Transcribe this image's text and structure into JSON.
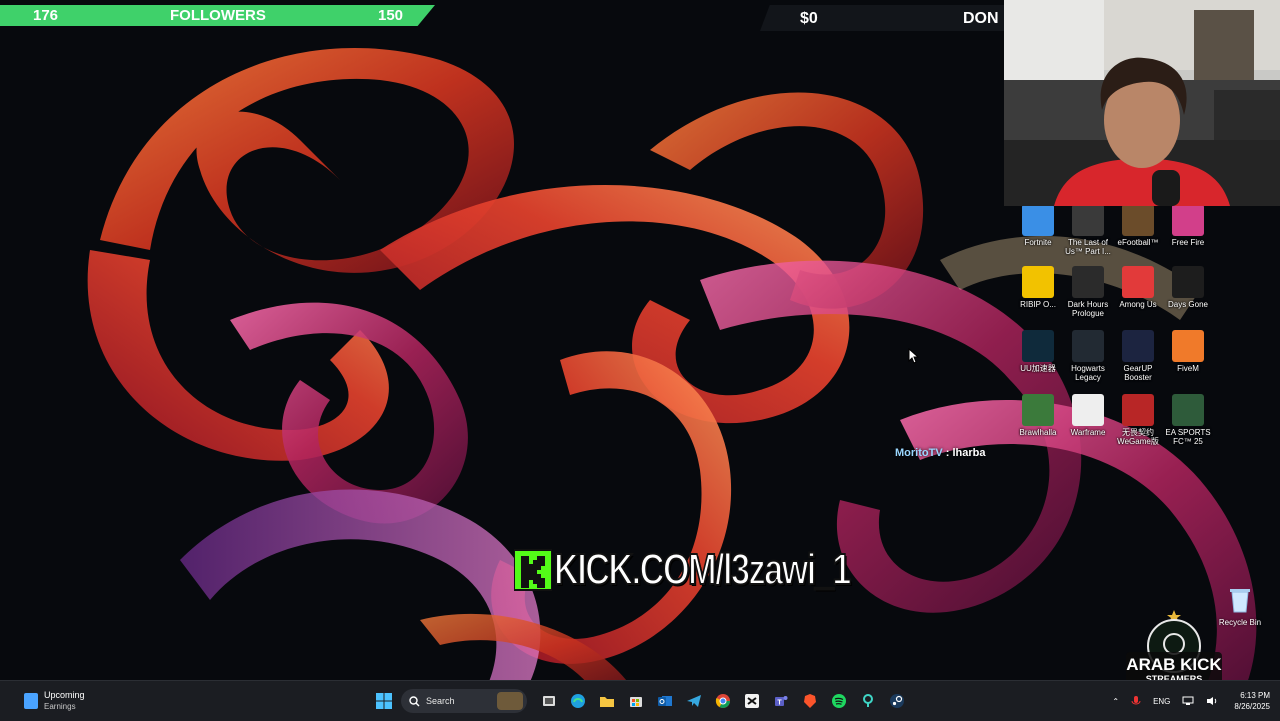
{
  "stream_overlay": {
    "followers_current": "176",
    "followers_label": "FOLLOWERS",
    "followers_goal": "150",
    "donation_amount": "$0",
    "donation_label": "DON",
    "kick_url": "KICK.COM/l3zawi_1",
    "watermark_line1": "ARAB KICK",
    "watermark_line2": "STREAMERS"
  },
  "chat": {
    "username": "MoritoTV",
    "separator": ":",
    "message": "lharba"
  },
  "desktop": {
    "icons": [
      {
        "label": "Fortnite",
        "icon": "fortnite-icon",
        "color": "#3a8fe6"
      },
      {
        "label": "The Last of Us™ Part I...",
        "icon": "last-of-us-icon",
        "color": "#3a3a3a"
      },
      {
        "label": "eFootball™",
        "icon": "efootball-icon",
        "color": "#6b4c2a"
      },
      {
        "label": "Free Fire",
        "icon": "free-fire-icon",
        "color": "#d23f8a"
      },
      {
        "label": "RIBIP O...",
        "icon": "ribip-icon",
        "color": "#f2c200"
      },
      {
        "label": "Dark Hours Prologue",
        "icon": "dark-hours-icon",
        "color": "#2b2b2b"
      },
      {
        "label": "Among Us",
        "icon": "among-us-icon",
        "color": "#e23a3a"
      },
      {
        "label": "Days Gone",
        "icon": "days-gone-icon",
        "color": "#1d1d1d"
      },
      {
        "label": "UU加速器",
        "icon": "uu-booster-icon",
        "color": "#0f2a3b"
      },
      {
        "label": "Hogwarts Legacy",
        "icon": "hogwarts-icon",
        "color": "#222a33"
      },
      {
        "label": "GearUP Booster",
        "icon": "gearup-icon",
        "color": "#1c2440"
      },
      {
        "label": "FiveM",
        "icon": "fivem-icon",
        "color": "#f07a2a"
      },
      {
        "label": "Brawlhalla",
        "icon": "brawlhalla-icon",
        "color": "#3b7a3b"
      },
      {
        "label": "Warframe",
        "icon": "warframe-icon",
        "color": "#eeeeee"
      },
      {
        "label": "无畏契约 WeGame版",
        "icon": "wegame-icon",
        "color": "#b82626"
      },
      {
        "label": "EA SPORTS FC™ 25",
        "icon": "ea-fc-icon",
        "color": "#2e5b3a"
      }
    ],
    "recycle_bin_label": "Recycle Bin"
  },
  "taskbar": {
    "widget_title": "Upcoming",
    "widget_subtitle": "Earnings",
    "search_placeholder": "Search",
    "tray_language": "ENG",
    "time": "6:13 PM",
    "date": "8/26/2025"
  },
  "colors": {
    "followers_bar": "#3fd16a",
    "kick_green": "#53fc18",
    "taskbar": "#1b1d22"
  }
}
